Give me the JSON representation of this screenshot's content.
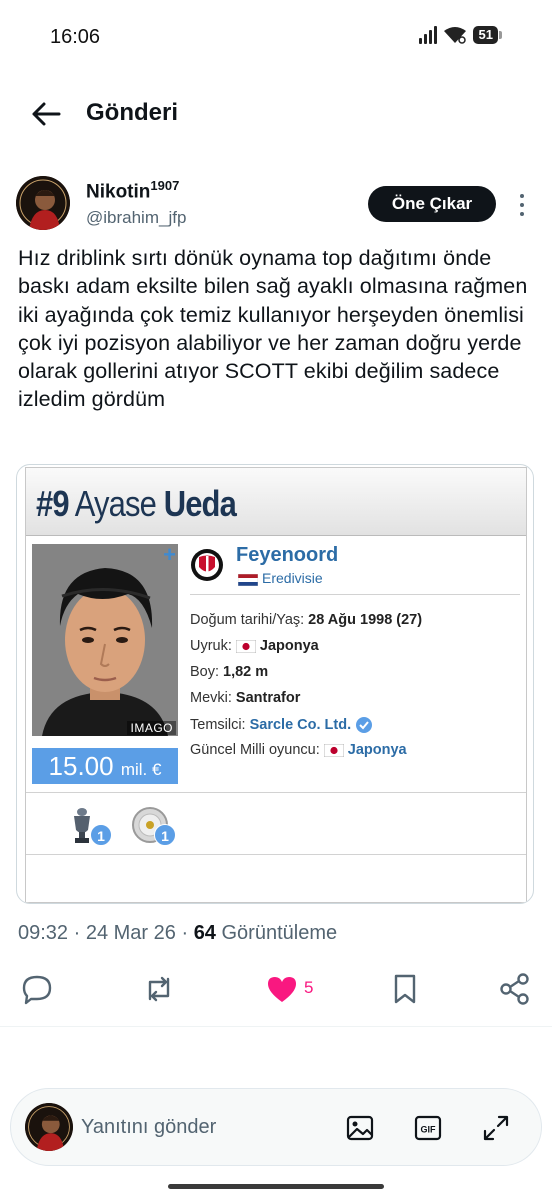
{
  "status_bar": {
    "time": "16:06",
    "battery": "51"
  },
  "header": {
    "title": "Gönderi"
  },
  "post": {
    "author_name": "Nikotin",
    "author_name_sup": "1907",
    "author_handle": "@ibrahim_jfp",
    "follow_label": "Öne Çıkar",
    "text": "Hız driblink sırtı dönük oynama top dağıtımı önde baskı adam eksilte bilen sağ ayaklı olmasına rağmen iki ayağında çok temiz kullanıyor herşeyden önemlisi çok iyi pozisyon alabiliyor ve her zaman doğru yerde olarak gollerini atıyor SCOTT ekibi değilim sadece izledim gördüm",
    "time": "09:32",
    "date": "24 Mar 26",
    "views_count": "64",
    "views_label": "Görüntüleme",
    "like_count": "5"
  },
  "card": {
    "number": "#9",
    "first_name": "Ayase",
    "last_name": "Ueda",
    "photo_credit": "IMAGO",
    "market_value": "15.00",
    "market_unit": "mil. €",
    "club": "Feyenoord",
    "league": "Eredivisie",
    "birth_label": "Doğum tarihi/Yaş:",
    "birth_value": "28 Ağu 1998 (27)",
    "nationality_label": "Uyruk:",
    "nationality_value": "Japonya",
    "height_label": "Boy:",
    "height_value": "1,82 m",
    "position_label": "Mevki:",
    "position_value": "Santrafor",
    "agent_label": "Temsilci:",
    "agent_value": "Sarcle Co. Ltd.",
    "national_label": "Güncel Milli oyuncu:",
    "national_value": "Japonya",
    "trophies": [
      {
        "icon": "cup-trophy-icon",
        "count": "1"
      },
      {
        "icon": "plate-trophy-icon",
        "count": "1"
      }
    ]
  },
  "reply": {
    "placeholder": "Yanıtını gönder"
  },
  "colors": {
    "like": "#f91880",
    "link": "#2c6ca6",
    "market_value_bg": "#5b9ee6",
    "card_title": "#1d3553"
  }
}
